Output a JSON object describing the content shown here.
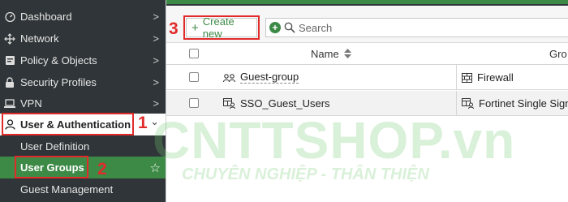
{
  "sidebar": {
    "items": [
      {
        "label": "Dashboard",
        "icon": "dashboard-icon",
        "chevron": ">"
      },
      {
        "label": "Network",
        "icon": "network-icon",
        "chevron": ">"
      },
      {
        "label": "Policy & Objects",
        "icon": "policy-icon",
        "chevron": ">"
      },
      {
        "label": "Security Profiles",
        "icon": "security-profiles-icon",
        "chevron": ">"
      },
      {
        "label": "VPN",
        "icon": "vpn-icon",
        "chevron": ">"
      },
      {
        "label": "User & Authentication",
        "icon": "user-icon",
        "chevron": "⌄"
      }
    ],
    "subitems": [
      {
        "label": "User Definition"
      },
      {
        "label": "User Groups"
      },
      {
        "label": "Guest Management"
      }
    ],
    "favorite_star": "☆"
  },
  "annotations": {
    "n1": "1",
    "n2": "2",
    "n3": "3"
  },
  "toolbar": {
    "create_label": "Create new",
    "create_plus": "+",
    "search_add": "+",
    "search_placeholder": "Search"
  },
  "table": {
    "columns": [
      "Name",
      "Gro"
    ],
    "sort_icon": "sort-icon",
    "rows": [
      {
        "name": "Guest-group",
        "name_icon": "group-icon",
        "type": "Firewall",
        "type_icon": "firewall-icon"
      },
      {
        "name": "SSO_Guest_Users",
        "name_icon": "sso-group-icon",
        "type": "Fortinet Single Sign-O",
        "type_icon": "fsso-icon"
      }
    ]
  },
  "watermark": {
    "line1": "CNTTSHOP.vn",
    "line2": "CHUYÊN NGHIỆP - THÂN THIỆN"
  },
  "colors": {
    "sidebar_bg": "#2f3538",
    "accent_green": "#3d8a46",
    "annotation_red": "#e12b2b"
  }
}
